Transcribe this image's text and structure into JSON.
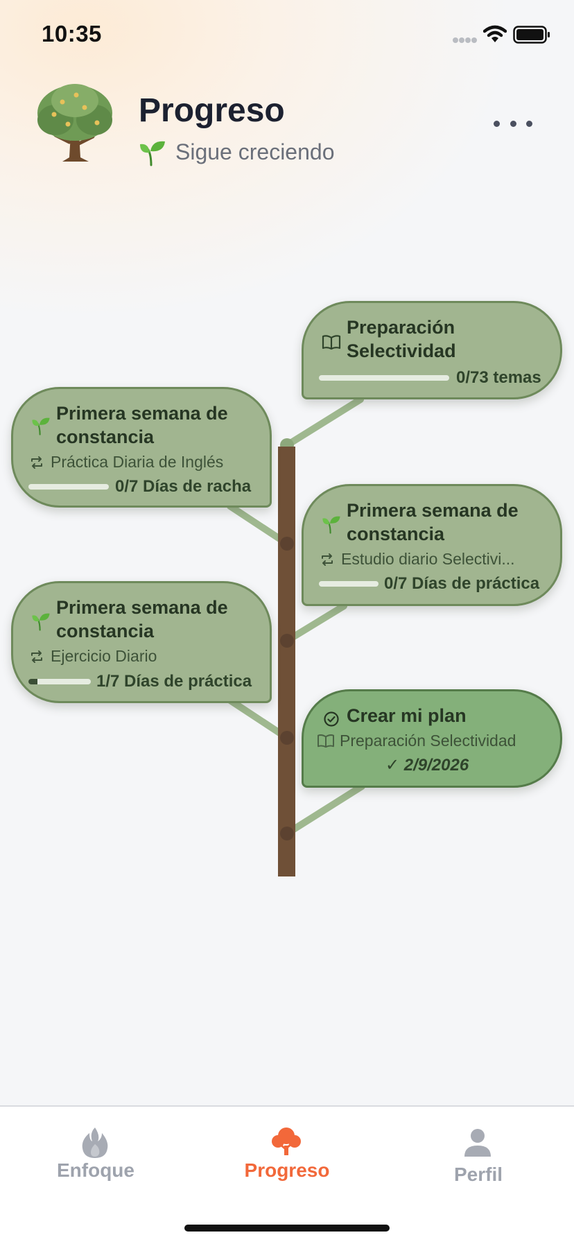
{
  "status_bar": {
    "time": "10:35"
  },
  "header": {
    "title": "Progreso",
    "subtitle": "Sigue creciendo"
  },
  "cards": [
    {
      "title_line1": "Preparación",
      "title_line2": "Selectividad",
      "icon": "book-icon",
      "progress_label": "0/73 temas",
      "progress": 0
    },
    {
      "title_line1": "Primera semana de",
      "title_line2": "constancia",
      "icon": "sprout-icon",
      "subtitle": "Práctica Diaria de Inglés",
      "progress_label": "0/7 Días de racha",
      "progress": 0
    },
    {
      "title_line1": "Primera semana de",
      "title_line2": "constancia",
      "icon": "sprout-icon",
      "subtitle": "Estudio diario Selectivi...",
      "progress_label": "0/7 Días de práctica",
      "progress": 0
    },
    {
      "title_line1": "Primera semana de",
      "title_line2": "constancia",
      "icon": "sprout-icon",
      "subtitle": "Ejercicio Diario",
      "progress_label": "1/7 Días de práctica",
      "progress": 0.14
    },
    {
      "title": "Crear mi plan",
      "icon": "check-circle-icon",
      "subtitle": "Preparación Selectividad",
      "date": "✓ 2/9/2026",
      "completed": true
    }
  ],
  "tabs": [
    {
      "label": "Enfoque",
      "icon": "flame-icon",
      "active": false
    },
    {
      "label": "Progreso",
      "icon": "tree-icon",
      "active": true
    },
    {
      "label": "Perfil",
      "icon": "person-icon",
      "active": false
    }
  ],
  "colors": {
    "accent": "#f2683a",
    "card": "#a1b590",
    "card_done": "#84b07a",
    "trunk": "#6f5037"
  }
}
